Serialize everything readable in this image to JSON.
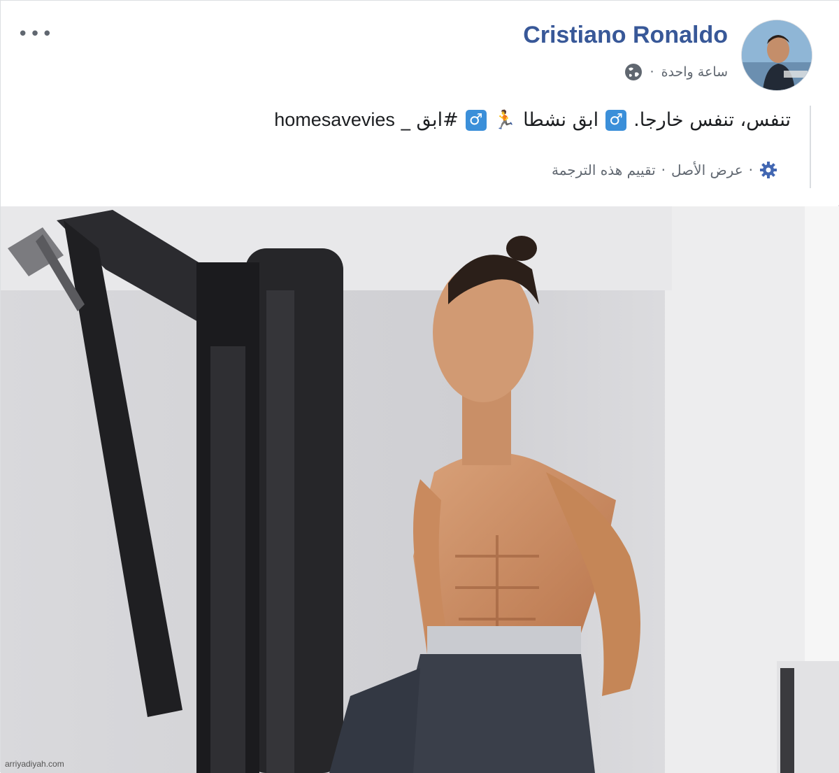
{
  "post": {
    "author": "Cristiano Ronaldo",
    "time": "ساعة واحدة",
    "meta_separator": "·",
    "privacy_icon": "globe-icon",
    "more_icon": "more-options-icon",
    "text": {
      "part1": "تنفس، تنفس خارجا.",
      "part2": "ابق نشطا",
      "part3": "#ابق _",
      "hashtag_latin": "homesavevies",
      "badge_symbol": "♂",
      "runner_emoji": "🏃",
      "badge_color": "#3b8fd9"
    },
    "translation": {
      "settings_icon": "gear-icon",
      "separator": "·",
      "see_original": "عرض الأصل",
      "rate_translation": "تقييم هذه الترجمة"
    }
  },
  "image": {
    "credit": "arriyadiyah.com",
    "description_icon": "photo-gym-man"
  },
  "colors": {
    "author_link": "#385898",
    "secondary_text": "#606770",
    "border": "#dddfe2"
  }
}
